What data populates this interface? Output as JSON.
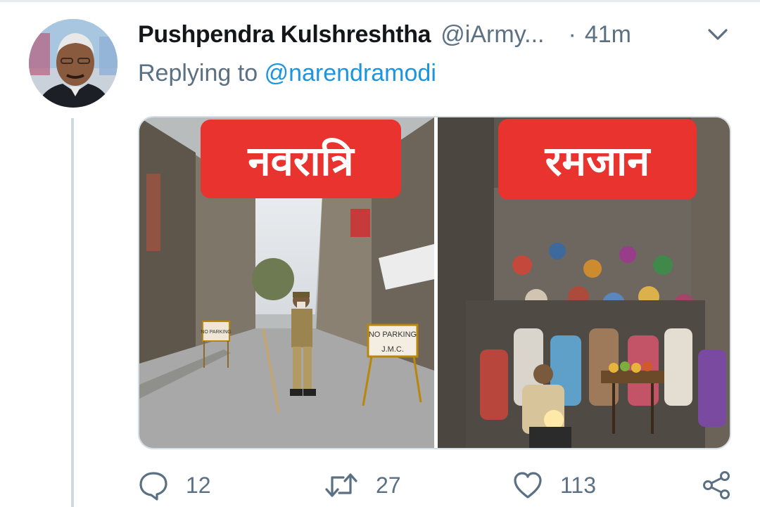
{
  "tweet": {
    "author_name": "Pushpendra Kulshreshtha",
    "author_handle": "@iArmy...",
    "separator": "·",
    "time": "41m",
    "reply_prefix": "Replying to",
    "reply_to": "@narendramodi"
  },
  "media": {
    "left_label": "नवरात्रि",
    "right_label": "रमजान",
    "left_signs": [
      "NO PARKING",
      "J.M.C."
    ],
    "left_signs_small": "NO PARKING"
  },
  "actions": {
    "replies": "12",
    "retweets": "27",
    "likes": "113"
  },
  "icons": {
    "menu": "chevron-down-icon",
    "reply": "speech-bubble-icon",
    "retweet": "retweet-icon",
    "like": "heart-icon",
    "share": "share-icon"
  },
  "colors": {
    "name": "#14171a",
    "secondary": "#5b7083",
    "mention": "#1b95e0",
    "label_red": "#e8332e"
  }
}
